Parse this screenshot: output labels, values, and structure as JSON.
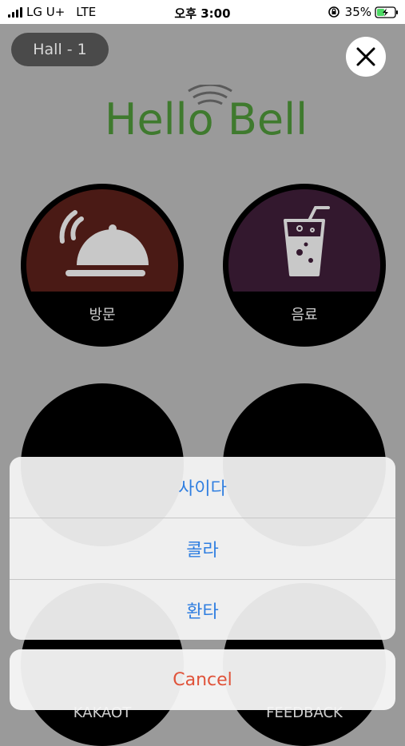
{
  "status_bar": {
    "carrier": "LG U+",
    "network": "LTE",
    "time": "오후 3:00",
    "battery": "35%"
  },
  "header": {
    "hall_label": "Hall - 1",
    "logo_text": "Hello Bell"
  },
  "menu": [
    {
      "label": "방문",
      "icon": "service-bell-icon",
      "color": "#4a1a15"
    },
    {
      "label": "음료",
      "icon": "drink-cup-icon",
      "color": "#33182e"
    },
    {
      "label": "",
      "icon": "",
      "color": "#000000"
    },
    {
      "label": "",
      "icon": "",
      "color": "#000000"
    },
    {
      "label": "KAKAOT",
      "icon": "",
      "color": "#000000"
    },
    {
      "label": "FEEDBACK",
      "icon": "",
      "color": "#000000"
    }
  ],
  "action_sheet": {
    "options": [
      "사이다",
      "콜라",
      "환타"
    ],
    "cancel_label": "Cancel"
  },
  "colors": {
    "logo_green": "#3f7a2e",
    "option_blue": "#2f7ee0",
    "cancel_red": "#e0533a"
  }
}
